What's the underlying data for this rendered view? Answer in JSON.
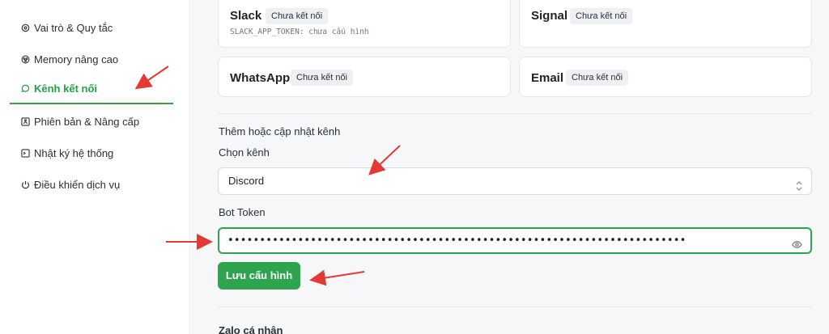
{
  "sidebar": {
    "items": [
      {
        "label": "Vai trò & Quy tắc",
        "icon": "role-icon"
      },
      {
        "label": "Memory nâng cao",
        "icon": "memory-icon"
      },
      {
        "label": "Kênh kết nối",
        "icon": "chat-bubble-icon",
        "active": true
      },
      {
        "label": "Phiên bản & Nâng cấp",
        "icon": "upgrade-icon"
      },
      {
        "label": "Nhật ký hệ thống",
        "icon": "terminal-icon"
      },
      {
        "label": "Điều khiển dịch vụ",
        "icon": "power-icon"
      }
    ]
  },
  "channels": {
    "slack": {
      "name": "Slack",
      "status": "Chưa kết nối",
      "env_hint": "SLACK_APP_TOKEN: chưa cấu hình"
    },
    "signal": {
      "name": "Signal",
      "status": "Chưa kết nối"
    },
    "whatsapp": {
      "name": "WhatsApp",
      "status": "Chưa kết nối"
    },
    "email": {
      "name": "Email",
      "status": "Chưa kết nối"
    }
  },
  "form": {
    "section_title": "Thêm hoặc cập nhật kênh",
    "channel_label": "Chọn kênh",
    "channel_value": "Discord",
    "token_label": "Bot Token",
    "token_value": "••••••••••••••••••••••••••••••••••••••••••••••••••••••••••••••••••••••••",
    "save_label": "Lưu cấu hình"
  },
  "next_section": {
    "title": "Zalo cá nhân"
  },
  "colors": {
    "accent": "#2ea44f",
    "annotation": "#e53935"
  }
}
